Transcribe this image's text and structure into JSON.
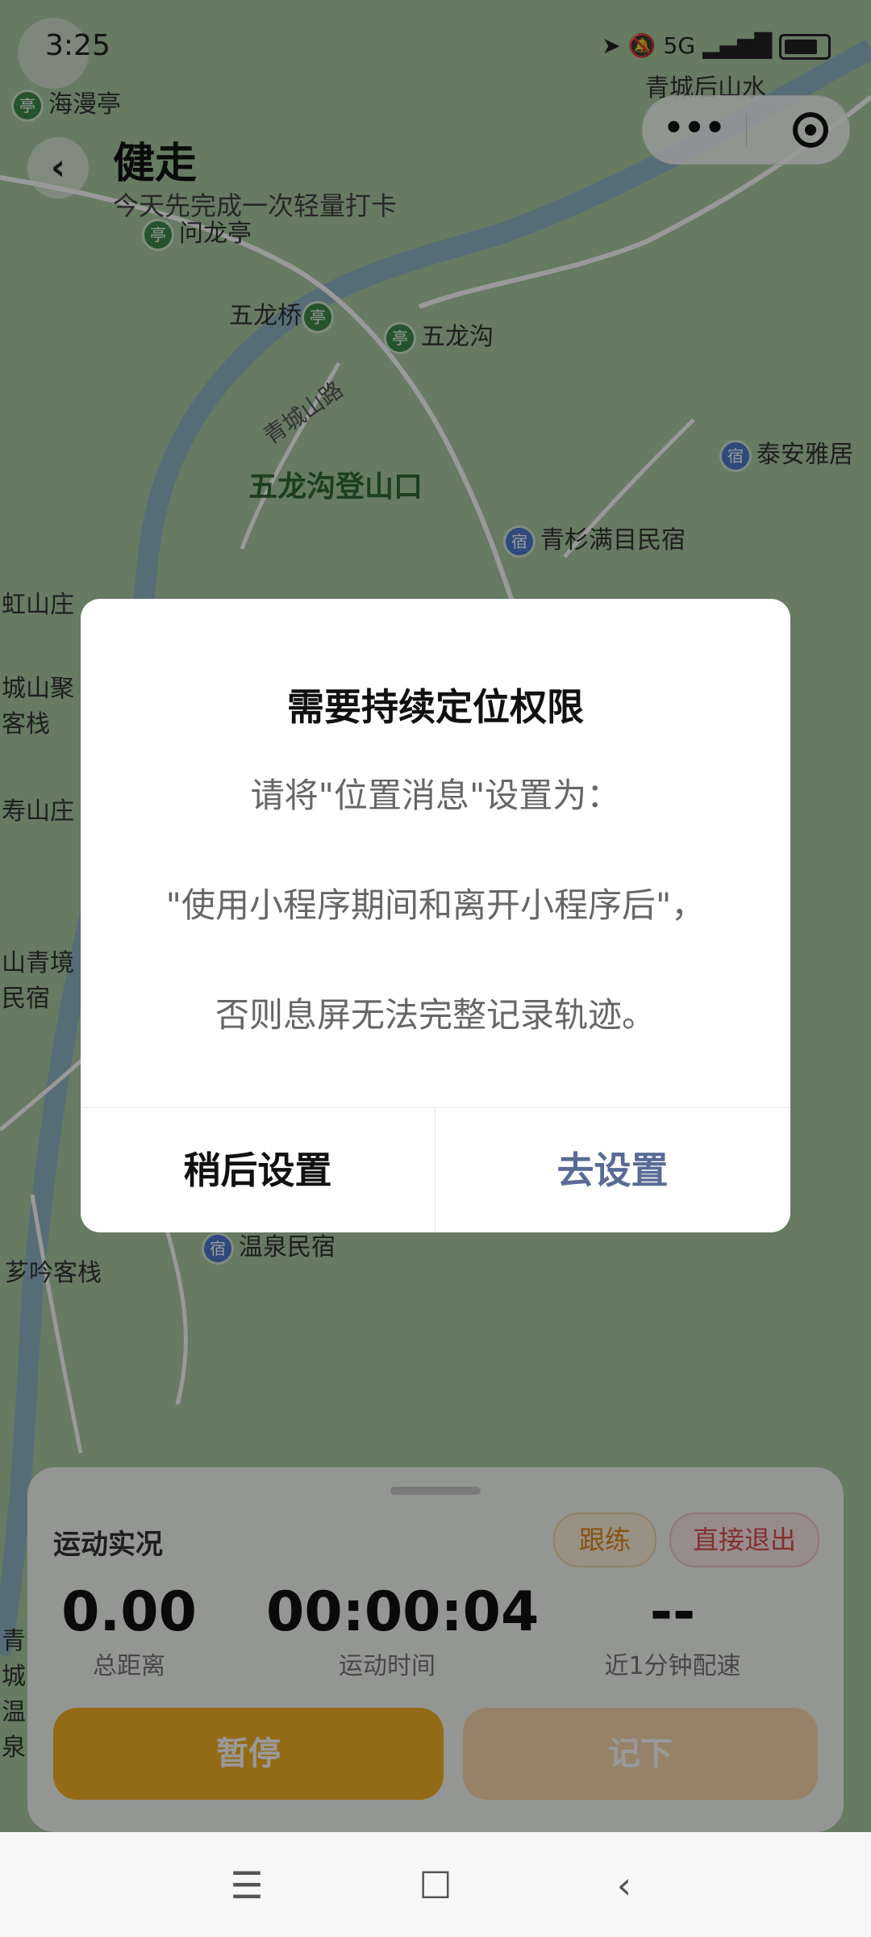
{
  "status_bar": {
    "time": "3:25",
    "network": "5G",
    "battery": "74"
  },
  "header": {
    "title": "健走",
    "subtitle": "今天先完成一次轻量打卡",
    "capsule_more": "•••"
  },
  "map": {
    "pois": [
      "海漫亭",
      "青城后山水",
      "问龙亭",
      "五龙桥",
      "五龙沟",
      "泰安雅居",
      "五龙沟登山口",
      "青杉满目民宿",
      "虹山庄",
      "城山聚客栈",
      "寿山庄",
      "山青境民宿",
      "温泉民宿",
      "芗吟客栈",
      "青城温泉"
    ],
    "road_label": "青城山路"
  },
  "dialog": {
    "title": "需要持续定位权限",
    "line1": "请将\"位置消息\"设置为：",
    "line2": "\"使用小程序期间和离开小程序后\"，",
    "line3": "否则息屏无法完整记录轨迹。",
    "cancel_label": "稍后设置",
    "confirm_label": "去设置"
  },
  "panel": {
    "title": "运动实况",
    "follow_label": "跟练",
    "exit_label": "直接退出",
    "distance_value": "0.00",
    "distance_label": "总距离",
    "duration_value": "00:00:04",
    "duration_label": "运动时间",
    "pace_value": "--",
    "pace_label": "近1分钟配速",
    "pause_label": "暂停",
    "record_label": "记下"
  },
  "navbar": {
    "menu_icon": "menu-icon",
    "home_icon": "home-icon",
    "back_icon": "back-icon"
  },
  "colors": {
    "accent_orange": "#f6b126",
    "link_blue": "#576b95",
    "exit_red": "#d9534f"
  }
}
